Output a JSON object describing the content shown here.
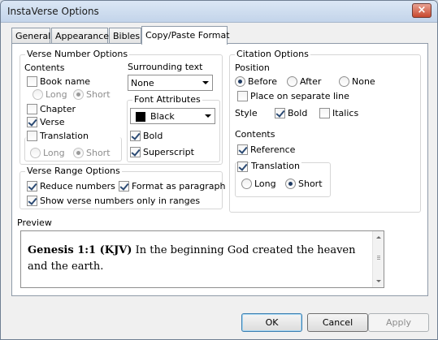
{
  "window": {
    "title": "InstaVerse Options",
    "close_glyph": "×"
  },
  "tabs": [
    {
      "label": "General"
    },
    {
      "label": "Appearance"
    },
    {
      "label": "Bibles"
    },
    {
      "label": "Copy/Paste Format",
      "active": true
    }
  ],
  "verse_number_options": {
    "legend": "Verse Number Options",
    "contents_label": "Contents",
    "book_name": {
      "label": "Book name",
      "checked": false
    },
    "book_format": {
      "long": "Long",
      "short": "Short",
      "selected": "Short"
    },
    "chapter": {
      "label": "Chapter",
      "checked": false
    },
    "verse": {
      "label": "Verse",
      "checked": true
    },
    "translation": {
      "label": "Translation",
      "checked": false
    },
    "translation_format": {
      "long": "Long",
      "short": "Short",
      "selected": "Short"
    },
    "surrounding_text_label": "Surrounding text",
    "surrounding_text_value": "None",
    "font_attributes": {
      "legend": "Font Attributes",
      "color_value": "Black",
      "bold": {
        "label": "Bold",
        "checked": true
      },
      "superscript": {
        "label": "Superscript",
        "checked": true
      }
    }
  },
  "verse_range_options": {
    "legend": "Verse Range Options",
    "reduce_numbers": {
      "label": "Reduce numbers",
      "checked": true
    },
    "format_as_paragraph": {
      "label": "Format as paragraph",
      "checked": true
    },
    "show_only_in_ranges": {
      "label": "Show verse numbers only in ranges",
      "checked": true
    }
  },
  "citation_options": {
    "legend": "Citation Options",
    "position_label": "Position",
    "position": {
      "before": "Before",
      "after": "After",
      "none": "None",
      "selected": "Before"
    },
    "separate_line": {
      "label": "Place on separate line",
      "checked": false
    },
    "style_label": "Style",
    "bold": {
      "label": "Bold",
      "checked": true
    },
    "italics": {
      "label": "Italics",
      "checked": false
    },
    "contents_label": "Contents",
    "reference": {
      "label": "Reference",
      "checked": true
    },
    "translation": {
      "label": "Translation",
      "checked": true
    },
    "translation_format": {
      "long": "Long",
      "short": "Short",
      "selected": "Short"
    }
  },
  "preview": {
    "label": "Preview",
    "citation": "Genesis 1:1 (KJV)",
    "text": " In the beginning God created the heaven and the earth."
  },
  "buttons": {
    "ok": "OK",
    "cancel": "Cancel",
    "apply": "Apply"
  }
}
